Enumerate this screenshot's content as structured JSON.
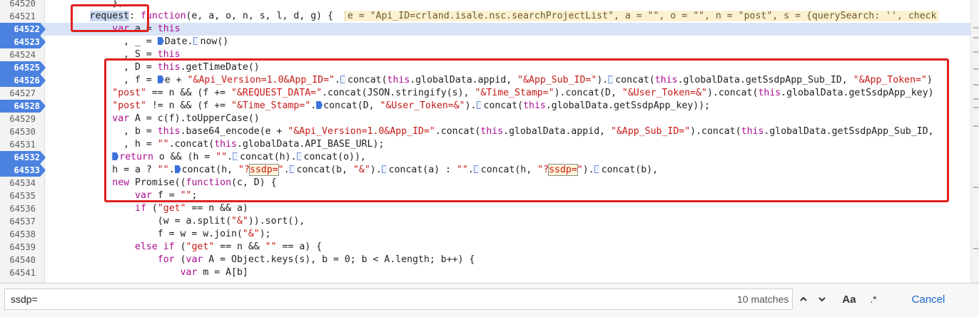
{
  "editor": {
    "lines": [
      {
        "num": "64520",
        "bp": false,
        "current": false,
        "tokens": [
          [
            "t",
            "            },"
          ]
        ]
      },
      {
        "num": "64521",
        "bp": false,
        "current": false,
        "tokens": [
          [
            "t",
            "        "
          ],
          [
            "sel",
            "request"
          ],
          [
            "t",
            ": "
          ],
          [
            "kw",
            "function"
          ],
          [
            "t",
            "(e, a, o, n, s, l, d, g) {  "
          ],
          [
            "inline",
            "e = \"Api_ID=crland.isale.nsc.searchProjectList\", a = \"\", o = \"\", n = \"post\", s = {querySearch: '', check"
          ]
        ]
      },
      {
        "num": "64522",
        "bp": true,
        "current": true,
        "tokens": [
          [
            "t",
            "            "
          ],
          [
            "kw",
            "var"
          ],
          [
            "t",
            " a = "
          ],
          [
            "kw",
            "this"
          ]
        ]
      },
      {
        "num": "64523",
        "bp": true,
        "current": false,
        "tokens": [
          [
            "t",
            "              , _ = "
          ],
          [
            "tks",
            ""
          ],
          [
            "t",
            "Date."
          ],
          [
            "tkh",
            ""
          ],
          [
            "t",
            "now()"
          ]
        ]
      },
      {
        "num": "64524",
        "bp": false,
        "current": false,
        "tokens": [
          [
            "t",
            "              , S = "
          ],
          [
            "kw",
            "this"
          ]
        ]
      },
      {
        "num": "64525",
        "bp": true,
        "current": false,
        "tokens": [
          [
            "t",
            "              , D = "
          ],
          [
            "kw",
            "this"
          ],
          [
            "t",
            ".getTimeDate()"
          ]
        ]
      },
      {
        "num": "64526",
        "bp": true,
        "current": false,
        "tokens": [
          [
            "t",
            "              , f = "
          ],
          [
            "tks",
            ""
          ],
          [
            "t",
            "e + "
          ],
          [
            "str",
            "\"&Api_Version=1.0&App_ID=\""
          ],
          [
            "t",
            "."
          ],
          [
            "tkh",
            ""
          ],
          [
            "t",
            "concat("
          ],
          [
            "kw",
            "this"
          ],
          [
            "t",
            ".globalData.appid, "
          ],
          [
            "str",
            "\"&App_Sub_ID=\""
          ],
          [
            "t",
            ")."
          ],
          [
            "tkh",
            ""
          ],
          [
            "t",
            "concat("
          ],
          [
            "kw",
            "this"
          ],
          [
            "t",
            ".globalData.getSsdpApp_Sub_ID, "
          ],
          [
            "str",
            "\"&App_Token=\""
          ],
          [
            "t",
            ")"
          ]
        ]
      },
      {
        "num": "64527",
        "bp": false,
        "current": false,
        "tokens": [
          [
            "t",
            "            "
          ],
          [
            "str",
            "\"post\""
          ],
          [
            "t",
            " == n && (f += "
          ],
          [
            "str",
            "\"&REQUEST_DATA=\""
          ],
          [
            "t",
            ".concat(JSON.stringify(s), "
          ],
          [
            "str",
            "\"&Time_Stamp=\""
          ],
          [
            "t",
            ").concat(D, "
          ],
          [
            "str",
            "\"&User_Token=&\""
          ],
          [
            "t",
            ").concat("
          ],
          [
            "kw",
            "this"
          ],
          [
            "t",
            ".globalData.getSsdpApp_key)"
          ]
        ]
      },
      {
        "num": "64528",
        "bp": true,
        "current": false,
        "tokens": [
          [
            "t",
            "            "
          ],
          [
            "str",
            "\"post\""
          ],
          [
            "t",
            " != n && (f += "
          ],
          [
            "str",
            "\"&Time_Stamp=\""
          ],
          [
            "t",
            "."
          ],
          [
            "tks",
            ""
          ],
          [
            "t",
            "concat(D, "
          ],
          [
            "str",
            "\"&User_Token=&\""
          ],
          [
            "t",
            ")."
          ],
          [
            "tkh",
            ""
          ],
          [
            "t",
            "concat("
          ],
          [
            "kw",
            "this"
          ],
          [
            "t",
            ".globalData.getSsdpApp_key));"
          ]
        ]
      },
      {
        "num": "64529",
        "bp": false,
        "current": false,
        "tokens": [
          [
            "t",
            "            "
          ],
          [
            "kw",
            "var"
          ],
          [
            "t",
            " A = c(f).toUpperCase()"
          ]
        ]
      },
      {
        "num": "64530",
        "bp": false,
        "current": false,
        "tokens": [
          [
            "t",
            "              , b = "
          ],
          [
            "kw",
            "this"
          ],
          [
            "t",
            ".base64_encode(e + "
          ],
          [
            "str",
            "\"&Api_Version=1.0&App_ID=\""
          ],
          [
            "t",
            ".concat("
          ],
          [
            "kw",
            "this"
          ],
          [
            "t",
            ".globalData.appid, "
          ],
          [
            "str",
            "\"&App_Sub_ID=\""
          ],
          [
            "t",
            ").concat("
          ],
          [
            "kw",
            "this"
          ],
          [
            "t",
            ".globalData.getSsdpApp_Sub_ID,"
          ]
        ]
      },
      {
        "num": "64531",
        "bp": false,
        "current": false,
        "tokens": [
          [
            "t",
            "              , h = "
          ],
          [
            "str",
            "\"\""
          ],
          [
            "t",
            ".concat("
          ],
          [
            "kw",
            "this"
          ],
          [
            "t",
            ".globalData.API_BASE_URL);"
          ]
        ]
      },
      {
        "num": "64532",
        "bp": true,
        "current": false,
        "tokens": [
          [
            "t",
            "            "
          ],
          [
            "tks",
            ""
          ],
          [
            "kw",
            "return"
          ],
          [
            "t",
            " o && (h = "
          ],
          [
            "str",
            "\"\""
          ],
          [
            "t",
            "."
          ],
          [
            "tkh",
            ""
          ],
          [
            "t",
            "concat(h)."
          ],
          [
            "tkh",
            ""
          ],
          [
            "t",
            "concat(o)),"
          ]
        ]
      },
      {
        "num": "64533",
        "bp": true,
        "current": false,
        "tokens": [
          [
            "t",
            "            h = a ? "
          ],
          [
            "str",
            "\"\""
          ],
          [
            "t",
            "."
          ],
          [
            "tks",
            ""
          ],
          [
            "t",
            "concat(h, "
          ],
          [
            "str",
            "\"?"
          ],
          [
            "match",
            "ssdp="
          ],
          [
            "str",
            "\""
          ],
          [
            "t",
            "."
          ],
          [
            "tkh",
            ""
          ],
          [
            "t",
            "concat(b, "
          ],
          [
            "str",
            "\"&\""
          ],
          [
            "t",
            ")."
          ],
          [
            "tkh",
            ""
          ],
          [
            "t",
            "concat(a) : "
          ],
          [
            "str",
            "\"\""
          ],
          [
            "t",
            "."
          ],
          [
            "tkh",
            ""
          ],
          [
            "t",
            "concat(h, "
          ],
          [
            "str",
            "\"?"
          ],
          [
            "match",
            "ssdp="
          ],
          [
            "str",
            "\""
          ],
          [
            "t",
            ")."
          ],
          [
            "tkh",
            ""
          ],
          [
            "t",
            "concat(b),"
          ]
        ]
      },
      {
        "num": "64534",
        "bp": false,
        "current": false,
        "tokens": [
          [
            "t",
            "            "
          ],
          [
            "kw",
            "new"
          ],
          [
            "t",
            " Promise(("
          ],
          [
            "kw",
            "function"
          ],
          [
            "t",
            "(c, D) {"
          ]
        ]
      },
      {
        "num": "64535",
        "bp": false,
        "current": false,
        "tokens": [
          [
            "t",
            "                "
          ],
          [
            "kw",
            "var"
          ],
          [
            "t",
            " f = "
          ],
          [
            "str",
            "\"\""
          ],
          [
            "t",
            ";"
          ]
        ]
      },
      {
        "num": "64536",
        "bp": false,
        "current": false,
        "tokens": [
          [
            "t",
            "                "
          ],
          [
            "kw",
            "if"
          ],
          [
            "t",
            " ("
          ],
          [
            "str",
            "\"get\""
          ],
          [
            "t",
            " == n && a)"
          ]
        ]
      },
      {
        "num": "64537",
        "bp": false,
        "current": false,
        "tokens": [
          [
            "t",
            "                    (w = a.split("
          ],
          [
            "str",
            "\"&\""
          ],
          [
            "t",
            ")).sort(),"
          ]
        ]
      },
      {
        "num": "64538",
        "bp": false,
        "current": false,
        "tokens": [
          [
            "t",
            "                    f = w = w.join("
          ],
          [
            "str",
            "\"&\""
          ],
          [
            "t",
            ");"
          ]
        ]
      },
      {
        "num": "64539",
        "bp": false,
        "current": false,
        "tokens": [
          [
            "t",
            "                "
          ],
          [
            "kw",
            "else if"
          ],
          [
            "t",
            " ("
          ],
          [
            "str",
            "\"get\""
          ],
          [
            "t",
            " == n && "
          ],
          [
            "str",
            "\"\""
          ],
          [
            "t",
            " == a) {"
          ]
        ]
      },
      {
        "num": "64540",
        "bp": false,
        "current": false,
        "tokens": [
          [
            "t",
            "                    "
          ],
          [
            "kw",
            "for"
          ],
          [
            "t",
            " ("
          ],
          [
            "kw",
            "var"
          ],
          [
            "t",
            " A = Object.keys(s), b = 0; b < A.length; b++) {"
          ]
        ]
      },
      {
        "num": "64541",
        "bp": false,
        "current": false,
        "tokens": [
          [
            "t",
            "                        "
          ],
          [
            "kw",
            "var"
          ],
          [
            "t",
            " m = A[b]"
          ]
        ]
      }
    ]
  },
  "find_bar": {
    "query": "ssdp=",
    "match_count": "10 matches",
    "prev_icon": "chevron-up-icon",
    "next_icon": "chevron-down-icon",
    "case_label": "Aa",
    "regex_label": ".*",
    "cancel_label": "Cancel"
  },
  "colors": {
    "annotation_red": "#e02020",
    "breakpoint_blue": "#4b82e0",
    "current_line": "#d8e4f6",
    "keyword": "#aa0d91",
    "string": "#c41a16"
  }
}
